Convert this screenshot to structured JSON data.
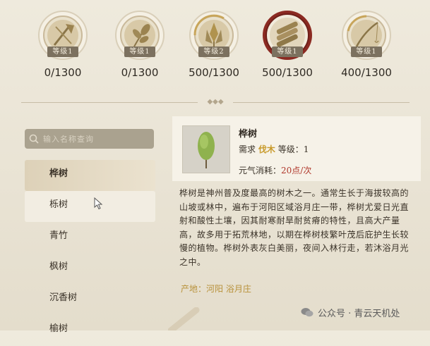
{
  "skills": [
    {
      "level": "等级1",
      "count": "0/1300",
      "icon": "axe-icon",
      "active": false
    },
    {
      "level": "等级1",
      "count": "0/1300",
      "icon": "herb-leaf-icon",
      "active": false
    },
    {
      "level": "等级2",
      "count": "500/1300",
      "icon": "wheat-icon",
      "active": false
    },
    {
      "level": "等级1",
      "count": "500/1300",
      "icon": "logs-icon",
      "active": true
    },
    {
      "level": "等级1",
      "count": "400/1300",
      "icon": "fishing-rod-icon",
      "active": false
    }
  ],
  "search": {
    "placeholder": "输入名称查询"
  },
  "list": {
    "items": [
      "桦树",
      "栎树",
      "青竹",
      "枫树",
      "沉香树",
      "榆树"
    ],
    "selected": 0
  },
  "detail": {
    "name": "桦树",
    "req_label": "需求",
    "req_skill": "伐木",
    "req_level": "等级：1",
    "cost_label": "元气消耗：",
    "cost_value": "20点/次",
    "description": "桦树是神州普及度最高的树木之一。通常生长于海拔较高的山坡或林中，遍布于河阳区域浴月庄一带，桦树尤爱日光直射和酸性土壤，因其耐寒耐旱耐贫瘠的特性，且高大产量高，故多用于拓荒林地，以期在桦树枝繁叶茂后庇护生长较慢的植物。桦树外表灰白美丽，夜间入林行走，若沐浴月光之中。",
    "origin": "产地：河阳 浴月庄"
  },
  "watermark": "公众号 · 青云天机处",
  "colors": {
    "gold": "#c89a2a",
    "red": "#b0382c",
    "medal_active": "#8b2a22"
  }
}
